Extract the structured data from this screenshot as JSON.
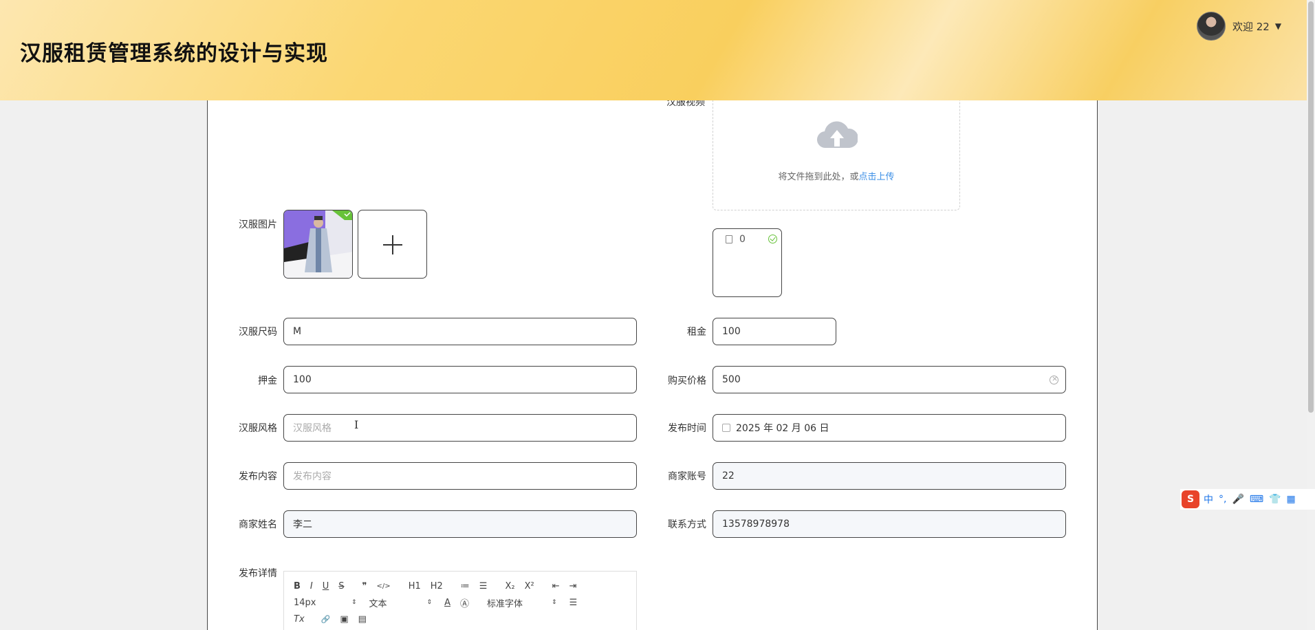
{
  "header": {
    "title": "汉服租赁管理系统的设计与实现",
    "welcome": "欢迎 22",
    "caret": "▼"
  },
  "colors": {
    "header_accent": "#f9cf5e",
    "link": "#3a8ee6",
    "success": "#67c23a"
  },
  "form": {
    "video_label": "汉服视频",
    "upload_text": "将文件拖到此处，或",
    "upload_link": "点击上传",
    "file_name": "0",
    "image_label": "汉服图片",
    "size_label": "汉服尺码",
    "size_value": "M",
    "rent_label": "租金",
    "rent_value": "100",
    "deposit_label": "押金",
    "deposit_value": "100",
    "price_label": "购买价格",
    "price_value": "500",
    "style_label": "汉服风格",
    "style_placeholder": "汉服风格",
    "date_label": "发布时间",
    "date_value": "2025 年 02 月 06 日",
    "content_label": "发布内容",
    "content_placeholder": "发布内容",
    "account_label": "商家账号",
    "account_value": "22",
    "merchant_label": "商家姓名",
    "merchant_value": "李二",
    "contact_label": "联系方式",
    "contact_value": "13578978978",
    "detail_label": "发布详情"
  },
  "editor": {
    "row1": [
      "B",
      "I",
      "U",
      "S",
      "❞",
      "</>",
      "H1",
      "H2",
      "≔",
      "☰",
      "X₂",
      "X²",
      "⇤",
      "⇥"
    ],
    "font_size": "14px",
    "text_type": "文本",
    "font_family": "标准字体",
    "row3": [
      "Tx",
      "🔗",
      "▣",
      "▤"
    ]
  },
  "ime": {
    "logo": "S",
    "items": [
      "中",
      "°,",
      "🎤",
      "⌨",
      "👕",
      "▦"
    ]
  }
}
